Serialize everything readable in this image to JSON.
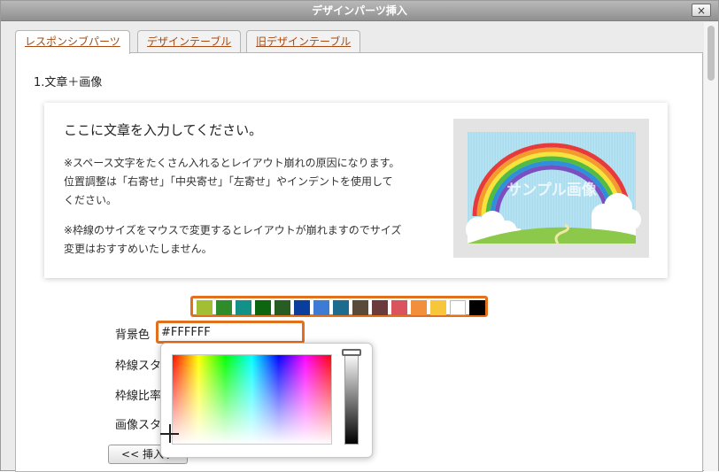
{
  "window": {
    "title": "デザインパーツ挿入",
    "close_label": "×"
  },
  "tabs": [
    {
      "label": "レスポンシブパーツ",
      "active": true
    },
    {
      "label": "デザインテーブル",
      "active": false
    },
    {
      "label": "旧デザインテーブル",
      "active": false
    }
  ],
  "section": {
    "title": "1.文章＋画像"
  },
  "card": {
    "heading": "ここに文章を入力してください。",
    "paragraph1": [
      "※スペース文字をたくさん入れるとレイアウト崩れの原因になります。",
      "位置調整は「右寄せ」「中央寄せ」「左寄せ」やインデントを使用して",
      "ください。"
    ],
    "paragraph2": [
      "※枠線のサイズをマウスで変更するとレイアウトが崩れますのでサイズ",
      "変更はおすすめいたしません。"
    ],
    "image_text": "サンプル画像"
  },
  "palette": [
    "#a2be32",
    "#2e8c2a",
    "#129188",
    "#0e650f",
    "#285c22",
    "#0a3d9c",
    "#3d7bd4",
    "#1d6b8f",
    "#5a4a3a",
    "#6b3a3a",
    "#d9545f",
    "#f18f3c",
    "#f7c63a",
    "#ffffff",
    "#000000"
  ],
  "form": {
    "bg_label": "背景色",
    "bg_value": "#FFFFFF",
    "border_style_label": "枠線スタ",
    "border_ratio_label": "枠線比率",
    "image_style_label": "画像スタ",
    "insert_label": "<< 挿入す"
  },
  "colors": {
    "accent": "#e2701d",
    "tab_text": "#a44a12"
  }
}
